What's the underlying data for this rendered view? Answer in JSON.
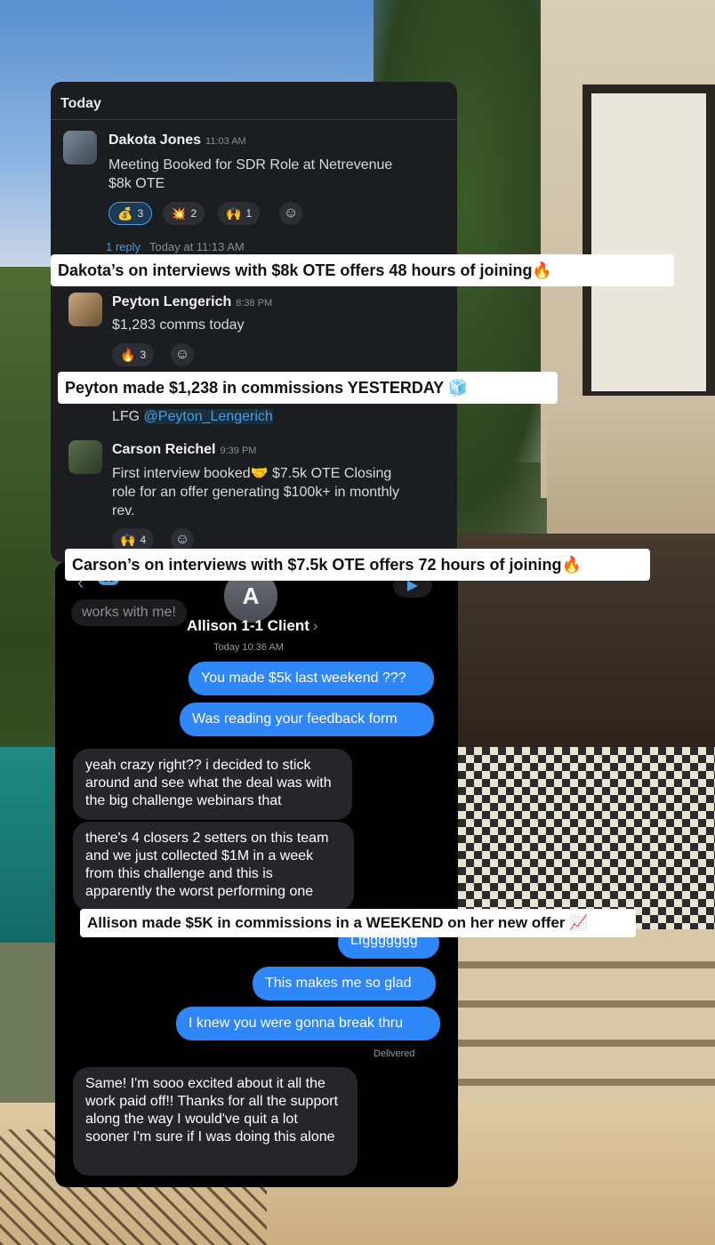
{
  "slack": {
    "day_label": "Today",
    "messages": [
      {
        "name": "Dakota Jones",
        "time": "11:03 AM",
        "text_lines": [
          "Meeting Booked for SDR Role at Netrevenue",
          "$8k OTE"
        ]
      },
      {
        "name": "Peyton Lengerich",
        "time": "8:38 PM",
        "text_lines": [
          "$1,283 comms today"
        ]
      },
      {
        "name": "Carson Reichel",
        "time": "9:39 PM",
        "text_lines": [
          "First interview booked🤝 $7.5k OTE Closing",
          "role for an offer generating $100k+ in monthly",
          "rev."
        ]
      }
    ],
    "reactions_dakota": [
      {
        "emoji": "💰",
        "count": "3"
      },
      {
        "emoji": "💥",
        "count": "2"
      },
      {
        "emoji": "🙌",
        "count": "1"
      }
    ],
    "reply": {
      "count": "1 reply",
      "time": "Today at 11:13 AM"
    },
    "reactions_peyton": [
      {
        "emoji": "🔥",
        "count": "3"
      }
    ],
    "lfg_prefix": "LFG ",
    "lfg_mention": "@Peyton_Lengerich",
    "reactions_carson": [
      {
        "emoji": "🙌",
        "count": "4"
      }
    ],
    "add_reaction_icon": "☺"
  },
  "captions": {
    "dakota": "Dakota’s on interviews with $8k OTE offers 48 hours of joining🔥",
    "peyton": "Peyton made $1,238 in commissions YESTERDAY 🧊",
    "carson": "Carson’s on interviews with $7.5k OTE offers 72 hours of joining🔥",
    "allison": "Allison made $5K in commissions in a WEEKEND on her new offer 📈"
  },
  "imessage": {
    "back_badge": "53",
    "ghost_text": "works with me!",
    "contact_initial": "A",
    "contact_name": "Allison 1-1 Client",
    "date": "Today 10:36 AM",
    "bubbles": [
      {
        "dir": "out",
        "text": "You made $5k last weekend ???"
      },
      {
        "dir": "out",
        "text": "Was reading your feedback form"
      },
      {
        "dir": "in",
        "text": "yeah crazy right?? i decided to stick around and see what the deal was with the big challenge webinars that"
      },
      {
        "dir": "in",
        "text": "there's 4 closers 2 setters on this team and we just collected $1M in a week from this challenge and this is apparently the worst performing one"
      },
      {
        "dir": "out",
        "text": "Lfggggggg"
      },
      {
        "dir": "out",
        "text": "This makes me so glad"
      },
      {
        "dir": "out",
        "text": "I knew you were gonna break thru"
      },
      {
        "dir": "in",
        "text": "Same! I'm sooo excited about it all the work paid off!! Thanks for all the support along the way I would've quit a lot sooner I'm sure if I was doing this alone"
      }
    ],
    "delivered": "Delivered"
  },
  "colors": {
    "imessage_blue": "#2f86f6",
    "slack_bg": "#1b1d21",
    "link_blue": "#4a9be0"
  }
}
